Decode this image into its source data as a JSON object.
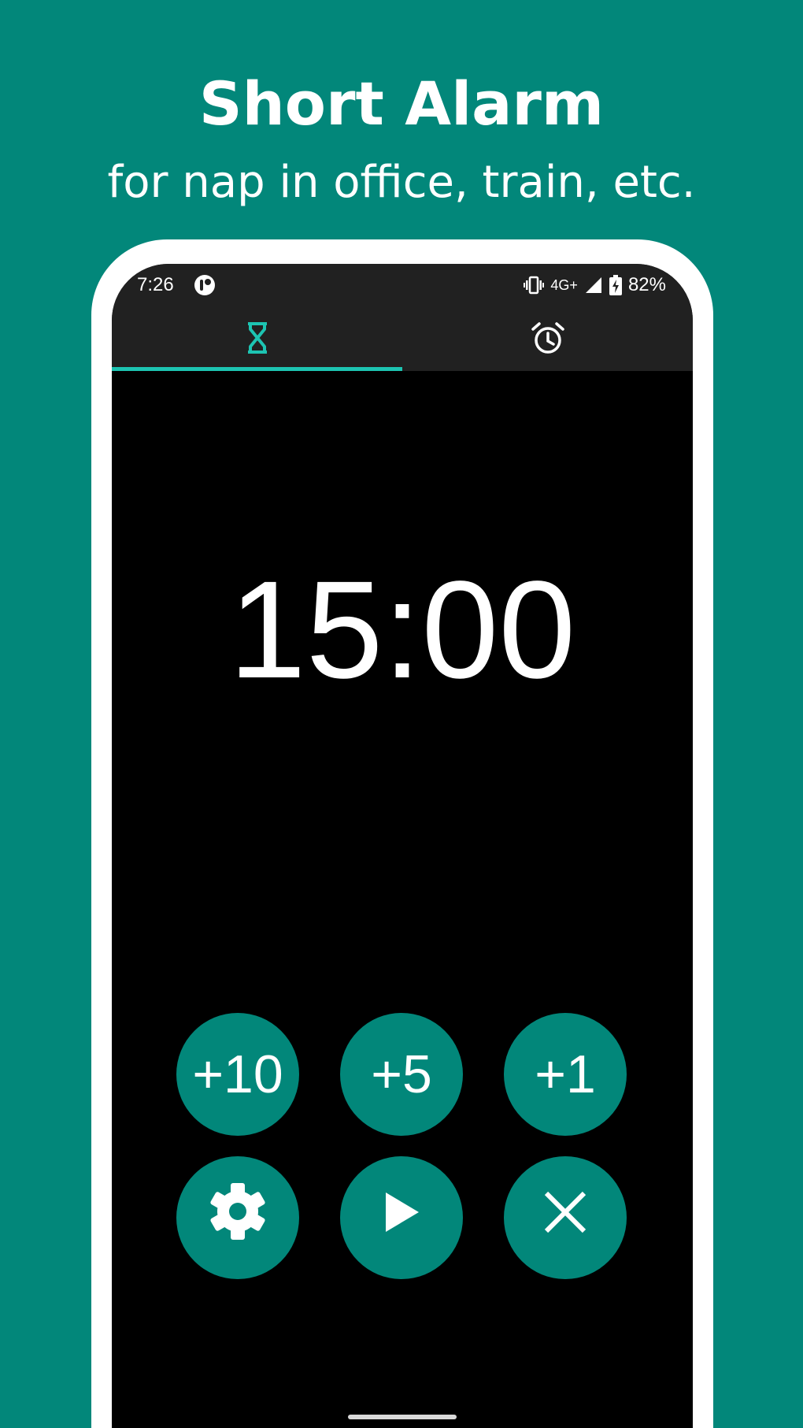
{
  "promo": {
    "title": "Short Alarm",
    "subtitle": "for nap in office, train, etc."
  },
  "status_bar": {
    "time": "7:26",
    "network": "4G+",
    "battery": "82%",
    "icons": [
      "app-notification-icon",
      "vibrate-icon",
      "signal-icon",
      "battery-charging-icon"
    ]
  },
  "tabs": [
    {
      "icon": "hourglass-icon",
      "selected": true
    },
    {
      "icon": "alarm-clock-icon",
      "selected": false
    }
  ],
  "timer": {
    "display": "15:00"
  },
  "buttons": {
    "add10": "+10",
    "add5": "+5",
    "add1": "+1",
    "settings_icon": "gear-icon",
    "start_icon": "play-icon",
    "cancel_icon": "close-icon"
  },
  "colors": {
    "background": "#02877A",
    "accent": "#1DC4B2",
    "button": "#02877A",
    "bar": "#212121"
  }
}
